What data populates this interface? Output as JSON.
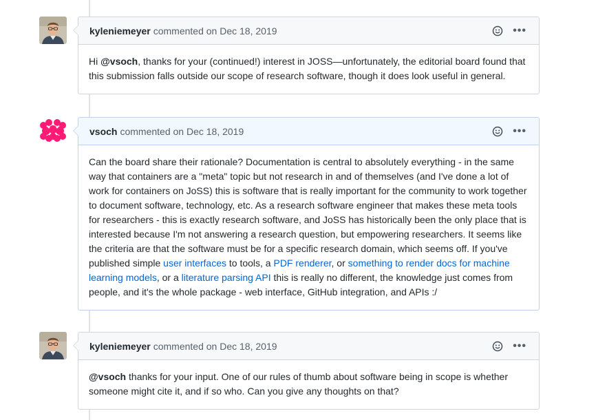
{
  "comments": [
    {
      "author": "kyleniemeyer",
      "meta": "commented on Dec 18, 2019",
      "avatar": "photo-avatar-icon",
      "body": {
        "p1": "Hi ",
        "mention": "@vsoch",
        "p2": ", thanks for your (continued!) interest in JOSS—unfortunately, the editorial board found that this submission falls outside our scope of research software, though it does look useful in general."
      }
    },
    {
      "author": "vsoch",
      "meta": "commented on Dec 18, 2019",
      "avatar": "pink-identicon-avatar",
      "body": {
        "t1": "Can the board share their rationale? Documentation is central to absolutely everything - in the same way that containers are a \"meta\" topic but not research in and of themselves (and I've done a lot of work for containers on JoSS) this is software that is really important for the community to work together to document software, technology, etc. As a research software engineer that makes these meta tools for researchers - this is exactly research software, and JoSS has historically been the only place that is interested because I'm not answering a research question, but empowering researchers. It seems like the criteria are that the software must be for a specific research domain, which seems off. If you've published simple ",
        "link1": "user interfaces",
        "t2": " to tools, a ",
        "link2": "PDF renderer",
        "t3": ", or ",
        "link3": "something to render docs for machine learning models",
        "t4": ", or a ",
        "link4": "literature parsing API",
        "t5": " this is really no different, the knowledge just comes from people, and it's the whole package - web interface, GitHub integration, and APIs :/"
      }
    },
    {
      "author": "kyleniemeyer",
      "meta": "commented on Dec 18, 2019",
      "avatar": "photo-avatar-icon",
      "body": {
        "mention": "@vsoch",
        "p2": " thanks for your input. One of our rules of thumb about software being in scope is whether someone might cite it, and if so who. Can you give any thoughts on that?"
      }
    }
  ],
  "icons": {
    "reaction": "smiley-icon",
    "more": "kebab-icon",
    "more_glyph": "•••"
  },
  "colors": {
    "link": "#0366d6",
    "header_bg": "#f6f8fa",
    "highlight_header_bg": "#f1f8ff",
    "identicon": "#ff1a75"
  }
}
